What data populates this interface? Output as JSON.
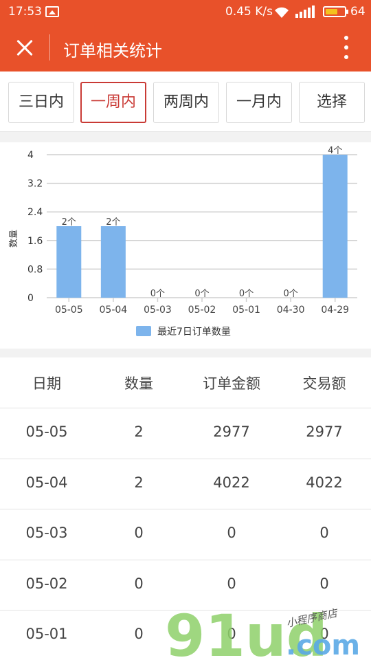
{
  "status_bar": {
    "time": "17:53",
    "net_speed": "0.45 K/s",
    "battery": "64",
    "battery_level": 0.64,
    "icons": [
      "picture-icon",
      "wifi-icon",
      "signal-icon",
      "battery-icon"
    ]
  },
  "header": {
    "title": "订单相关统计",
    "icons": [
      "close-icon",
      "more-vertical-icon"
    ]
  },
  "filters": {
    "items": [
      {
        "label": "三日内",
        "active": false
      },
      {
        "label": "一周内",
        "active": true
      },
      {
        "label": "两周内",
        "active": false
      },
      {
        "label": "一月内",
        "active": false
      },
      {
        "label": "选择",
        "active": false
      }
    ]
  },
  "chart_data": {
    "type": "bar",
    "categories": [
      "05-05",
      "05-04",
      "05-03",
      "05-02",
      "05-01",
      "04-30",
      "04-29"
    ],
    "series": [
      {
        "name": "最近7日订单数量",
        "values": [
          2,
          2,
          0,
          0,
          0,
          0,
          4
        ]
      }
    ],
    "data_labels": [
      "2个",
      "2个",
      "0个",
      "0个",
      "0个",
      "0个",
      "4个"
    ],
    "ylabel": "数量",
    "xlabel": "",
    "ylim": [
      0,
      4
    ],
    "yticks": [
      "0",
      "0.8",
      "1.6",
      "2.4",
      "3.2",
      "4"
    ],
    "grid": true,
    "legend_position": "bottom",
    "bar_color": "#7db4ec"
  },
  "table": {
    "headers": [
      "日期",
      "数量",
      "订单金额",
      "交易额"
    ],
    "rows": [
      [
        "05-05",
        "2",
        "2977",
        "2977"
      ],
      [
        "05-04",
        "2",
        "4022",
        "4022"
      ],
      [
        "05-03",
        "0",
        "0",
        "0"
      ],
      [
        "05-02",
        "0",
        "0",
        "0"
      ],
      [
        "05-01",
        "0",
        "0",
        "0"
      ]
    ]
  },
  "watermark": {
    "brand": "91ud",
    "domain": ".com",
    "tagline": "小程序商店"
  },
  "colors": {
    "brand": "#e8512a",
    "active": "#c93a35",
    "bar": "#7db4ec",
    "watermark_green": "#8fd16a",
    "watermark_blue": "#5aa9e6"
  }
}
